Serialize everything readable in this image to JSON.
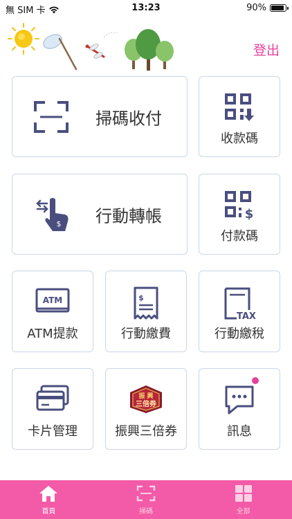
{
  "status_bar": {
    "carrier": "無 SIM 卡",
    "time": "13:23",
    "battery_percent": "90%",
    "battery_level": 0.9
  },
  "header": {
    "logout_label": "登出",
    "accent_color": "#e8419b"
  },
  "tiles": {
    "scan_pay": "掃碼收付",
    "receive_code": "收款碼",
    "mobile_transfer": "行動轉帳",
    "pay_code": "付款碼",
    "atm_withdraw": "ATM提款",
    "atm_icon_text": "ATM",
    "bill_pay": "行動繳費",
    "tax_pay": "行動繳稅",
    "tax_icon_text": "TAX",
    "card_manage": "卡片管理",
    "triple_voucher": "振興三倍券",
    "voucher_icon_line1": "振 興",
    "voucher_icon_line2": "三倍券",
    "messages": "訊息"
  },
  "tabbar": {
    "background": "#f35aa7",
    "items": [
      {
        "label": "首頁",
        "icon": "home-icon",
        "active": true
      },
      {
        "label": "掃碼",
        "icon": "scan-icon",
        "active": false
      },
      {
        "label": "全部",
        "icon": "grid-icon",
        "active": false
      }
    ]
  }
}
